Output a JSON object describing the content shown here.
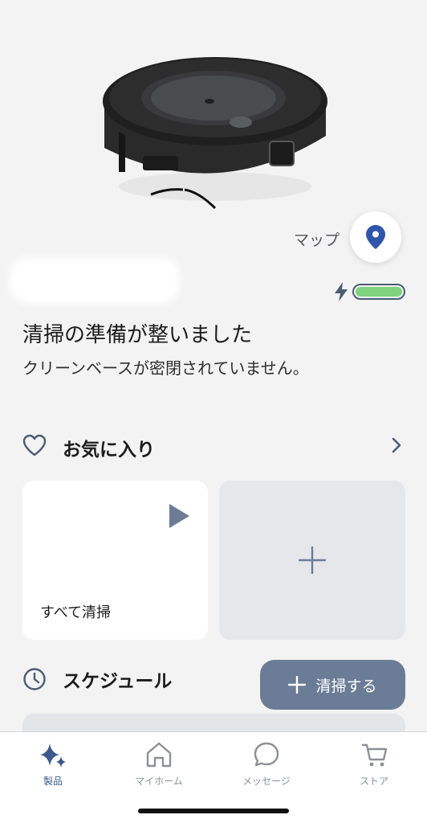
{
  "map": {
    "label": "マップ"
  },
  "robot": {
    "name": ""
  },
  "battery": {
    "level_percent": 100,
    "fill_color": "#7fd37f"
  },
  "status": {
    "title": "清掃の準備が整いました",
    "subtitle": "クリーンベースが密閉されていません。"
  },
  "favorites": {
    "title": "お気に入り",
    "cards": [
      {
        "label": "すべて清掃"
      }
    ]
  },
  "schedule": {
    "title": "スケジュール"
  },
  "actions": {
    "clean_label": "清掃する"
  },
  "tabs": [
    {
      "label": "製品",
      "icon": "sparkle-icon",
      "active": true
    },
    {
      "label": "マイホーム",
      "icon": "home-icon",
      "active": false
    },
    {
      "label": "メッセージ",
      "icon": "chat-bubble-icon",
      "active": false
    },
    {
      "label": "ストア",
      "icon": "cart-icon",
      "active": false
    }
  ],
  "colors": {
    "accent": "#3b5a8a",
    "primary_button": "#6b7d96",
    "background": "#f3f3f3"
  }
}
